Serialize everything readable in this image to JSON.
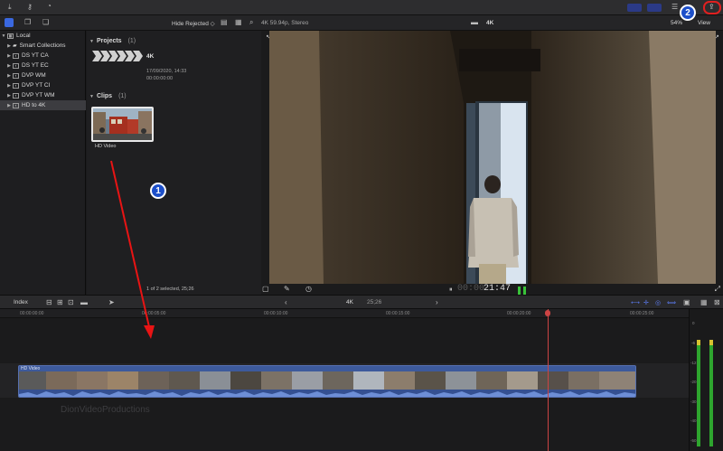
{
  "toolbar": {
    "filter_label": "Hide Rejected ◇",
    "viewer_format": "4K 59.94p, Stereo",
    "project_label": "4K",
    "zoom_label": "54%",
    "view_label": "View"
  },
  "sidebar": {
    "items": [
      {
        "label": "Local",
        "kind": "library"
      },
      {
        "label": "Smart Collections",
        "kind": "folder"
      },
      {
        "label": "DS YT CA",
        "kind": "event"
      },
      {
        "label": "DS YT EC",
        "kind": "event"
      },
      {
        "label": "DVP WM",
        "kind": "event"
      },
      {
        "label": "DVP YT CI",
        "kind": "event"
      },
      {
        "label": "DVP YT WM",
        "kind": "event"
      },
      {
        "label": "HD to 4K",
        "kind": "event"
      }
    ]
  },
  "browser": {
    "projects_header": "Projects",
    "projects_count": "(1)",
    "project_name": "4K",
    "project_date": "17/09/2020, 14:33",
    "project_duration": "00:00:00:00",
    "clips_header": "Clips",
    "clips_count": "(1)",
    "clip_name": "HD Video",
    "selection_status": "1 of 2 selected, 25;26"
  },
  "viewer": {
    "timecode": "21:47"
  },
  "timeline": {
    "index_label": "Index",
    "project_label": "4K",
    "duration_label": "25;26",
    "ruler_ticks": [
      "00:00:00:00",
      "00:00:05:00",
      "00:00:10:00",
      "00:00:15:00",
      "00:00:20:00",
      "00:00:25:00"
    ],
    "clip_label": "HD Video",
    "watermark": "DionVideoProductions"
  },
  "meters": {
    "scale": [
      "0",
      "-6",
      "-12",
      "-20",
      "-30",
      "-40",
      "-50"
    ]
  },
  "annotations": {
    "badge1": "1",
    "badge2": "2"
  },
  "colors": {
    "accent_blue": "#1d4fc9",
    "arrow_red": "#e81414",
    "clip_blue": "#3d5a9c",
    "playhead": "#c44"
  }
}
